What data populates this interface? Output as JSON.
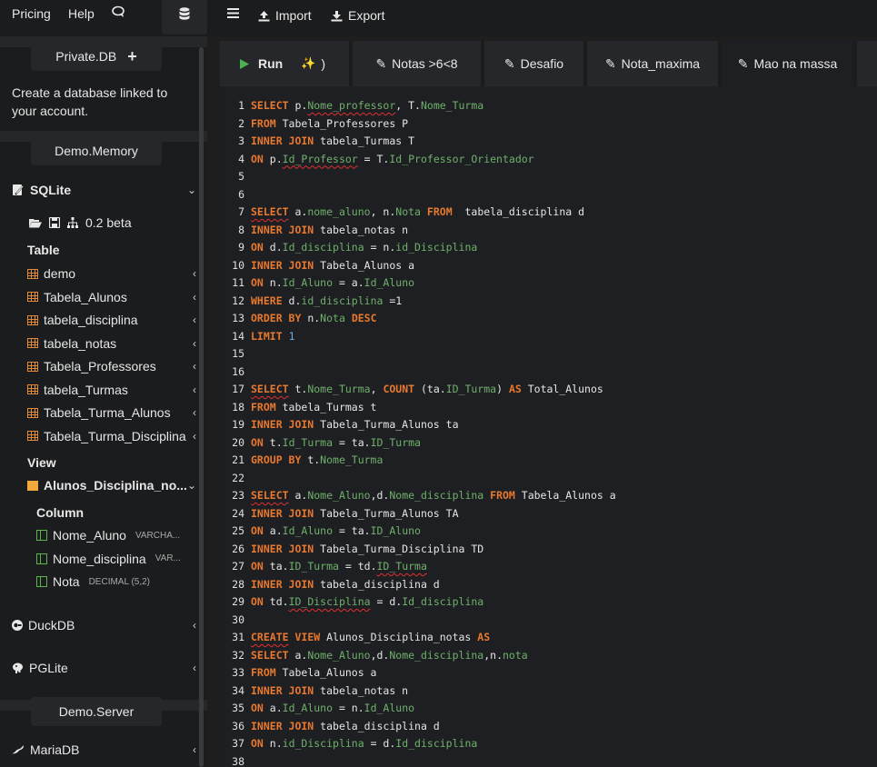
{
  "topbar": {
    "pricing": "Pricing",
    "help": "Help",
    "import_label": "Import",
    "export_label": "Export"
  },
  "sidebar": {
    "private_db": "Private.DB",
    "create_note": "Create a database linked to your account.",
    "demo_memory": "Demo.Memory",
    "sqlite": "SQLite",
    "version": "0.2 beta",
    "table_heading": "Table",
    "tables": [
      "demo",
      "Tabela_Alunos",
      "tabela_disciplina",
      "tabela_notas",
      "Tabela_Professores",
      "tabela_Turmas",
      "Tabela_Turma_Alunos",
      "Tabela_Turma_Disciplina"
    ],
    "view_heading": "View",
    "view_name": "Alunos_Disciplina_no...",
    "column_heading": "Column",
    "columns": [
      {
        "name": "Nome_Aluno",
        "type": "VARCHA..."
      },
      {
        "name": "Nome_disciplina",
        "type": "VAR..."
      },
      {
        "name": "Nota",
        "type": "DECIMAL (5,2)"
      }
    ],
    "duckdb": "DuckDB",
    "pglite": "PGLite",
    "demo_server": "Demo.Server",
    "mariadb": "MariaDB"
  },
  "tabs": {
    "run": "Run",
    "run_suffix": ")",
    "items": [
      "Notas >6<8",
      "Desafio",
      "Nota_maxima",
      "Mao na massa"
    ]
  },
  "editor": {
    "lines": [
      [
        [
          "kw",
          "SELECT"
        ],
        [
          "txt",
          " p."
        ],
        [
          "fld sq",
          "Nome_professor"
        ],
        [
          "txt",
          ", T."
        ],
        [
          "fld",
          "Nome_Turma"
        ]
      ],
      [
        [
          "kw",
          "FROM"
        ],
        [
          "txt",
          " Tabela_Professores P"
        ]
      ],
      [
        [
          "kw",
          "INNER JOIN"
        ],
        [
          "txt",
          " tabela_Turmas T"
        ]
      ],
      [
        [
          "kw",
          "ON"
        ],
        [
          "txt",
          " p."
        ],
        [
          "fld sq",
          "Id_Professor"
        ],
        [
          "txt",
          " = T."
        ],
        [
          "fld",
          "Id_Professor_Orientador"
        ]
      ],
      [],
      [],
      [
        [
          "kw sq",
          "SELECT"
        ],
        [
          "txt",
          " a."
        ],
        [
          "fld",
          "nome_aluno"
        ],
        [
          "txt",
          ", n."
        ],
        [
          "fld",
          "Nota"
        ],
        [
          "txt",
          " "
        ],
        [
          "kw",
          "FROM"
        ],
        [
          "txt",
          "  tabela_disciplina d"
        ]
      ],
      [
        [
          "kw",
          "INNER JOIN"
        ],
        [
          "txt",
          " tabela_notas n"
        ]
      ],
      [
        [
          "kw",
          "ON"
        ],
        [
          "txt",
          " d."
        ],
        [
          "fld",
          "Id_disciplina"
        ],
        [
          "txt",
          " = n."
        ],
        [
          "fld",
          "id_Disciplina"
        ]
      ],
      [
        [
          "kw",
          "INNER JOIN"
        ],
        [
          "txt",
          " Tabela_Alunos a"
        ]
      ],
      [
        [
          "kw",
          "ON"
        ],
        [
          "txt",
          " n."
        ],
        [
          "fld",
          "Id_Aluno"
        ],
        [
          "txt",
          " = a."
        ],
        [
          "fld",
          "Id_Aluno"
        ]
      ],
      [
        [
          "kw",
          "WHERE"
        ],
        [
          "txt",
          " d."
        ],
        [
          "fld",
          "id_disciplina"
        ],
        [
          "txt",
          " =1"
        ]
      ],
      [
        [
          "kw",
          "ORDER BY"
        ],
        [
          "txt",
          " n."
        ],
        [
          "fld",
          "Nota"
        ],
        [
          "txt",
          " "
        ],
        [
          "kw",
          "DESC"
        ]
      ],
      [
        [
          "kw",
          "LIMIT"
        ],
        [
          "txt",
          " "
        ],
        [
          "num",
          "1"
        ]
      ],
      [],
      [],
      [
        [
          "kw sq",
          "SELECT"
        ],
        [
          "txt",
          " t."
        ],
        [
          "fld",
          "Nome_Turma"
        ],
        [
          "txt",
          ", "
        ],
        [
          "kw",
          "COUNT"
        ],
        [
          "txt",
          " (ta."
        ],
        [
          "fld",
          "ID_Turma"
        ],
        [
          "txt",
          ") "
        ],
        [
          "kw",
          "AS"
        ],
        [
          "txt",
          " Total_Alunos"
        ]
      ],
      [
        [
          "kw",
          "FROM"
        ],
        [
          "txt",
          " tabela_Turmas t"
        ]
      ],
      [
        [
          "kw",
          "INNER JOIN"
        ],
        [
          "txt",
          " Tabela_Turma_Alunos ta"
        ]
      ],
      [
        [
          "kw",
          "ON"
        ],
        [
          "txt",
          " t."
        ],
        [
          "fld",
          "Id_Turma"
        ],
        [
          "txt",
          " = ta."
        ],
        [
          "fld",
          "ID_Turma"
        ]
      ],
      [
        [
          "kw",
          "GROUP BY"
        ],
        [
          "txt",
          " t."
        ],
        [
          "fld",
          "Nome_Turma"
        ]
      ],
      [],
      [
        [
          "kw sq",
          "SELECT"
        ],
        [
          "txt",
          " a."
        ],
        [
          "fld",
          "Nome_Aluno"
        ],
        [
          "txt",
          ",d."
        ],
        [
          "fld",
          "Nome_disciplina"
        ],
        [
          "txt",
          " "
        ],
        [
          "kw",
          "FROM"
        ],
        [
          "txt",
          " Tabela_Alunos a"
        ]
      ],
      [
        [
          "kw",
          "INNER JOIN"
        ],
        [
          "txt",
          " Tabela_Turma_Alunos TA"
        ]
      ],
      [
        [
          "kw",
          "ON"
        ],
        [
          "txt",
          " a."
        ],
        [
          "fld",
          "Id_Aluno"
        ],
        [
          "txt",
          " = ta."
        ],
        [
          "fld",
          "ID_Aluno"
        ]
      ],
      [
        [
          "kw",
          "INNER JOIN"
        ],
        [
          "txt",
          " Tabela_Turma_Disciplina TD"
        ]
      ],
      [
        [
          "kw",
          "ON"
        ],
        [
          "txt",
          " ta."
        ],
        [
          "fld",
          "ID_Turma"
        ],
        [
          "txt",
          " = td."
        ],
        [
          "fld sq",
          "ID_Turma"
        ]
      ],
      [
        [
          "kw",
          "INNER JOIN"
        ],
        [
          "txt",
          " tabela_disciplina d"
        ]
      ],
      [
        [
          "kw",
          "ON"
        ],
        [
          "txt",
          " td."
        ],
        [
          "fld sq",
          "ID_Disciplina"
        ],
        [
          "txt",
          " = d."
        ],
        [
          "fld",
          "Id_disciplina"
        ]
      ],
      [],
      [
        [
          "kw sq",
          "CREATE"
        ],
        [
          "txt",
          " "
        ],
        [
          "kw",
          "VIEW"
        ],
        [
          "txt",
          " Alunos_Disciplina_notas "
        ],
        [
          "kw",
          "AS"
        ]
      ],
      [
        [
          "kw",
          "SELECT"
        ],
        [
          "txt",
          " a."
        ],
        [
          "fld",
          "Nome_Aluno"
        ],
        [
          "txt",
          ",d."
        ],
        [
          "fld",
          "Nome_disciplina"
        ],
        [
          "txt",
          ",n."
        ],
        [
          "fld",
          "nota"
        ]
      ],
      [
        [
          "kw",
          "FROM"
        ],
        [
          "txt",
          " Tabela_Alunos a"
        ]
      ],
      [
        [
          "kw",
          "INNER JOIN"
        ],
        [
          "txt",
          " tabela_notas n"
        ]
      ],
      [
        [
          "kw",
          "ON"
        ],
        [
          "txt",
          " a."
        ],
        [
          "fld",
          "Id_Aluno"
        ],
        [
          "txt",
          " = n."
        ],
        [
          "fld",
          "Id_Aluno"
        ]
      ],
      [
        [
          "kw",
          "INNER JOIN"
        ],
        [
          "txt",
          " tabela_disciplina d"
        ]
      ],
      [
        [
          "kw",
          "ON"
        ],
        [
          "txt",
          " n."
        ],
        [
          "fld",
          "id_Disciplina"
        ],
        [
          "txt",
          " = d."
        ],
        [
          "fld",
          "Id_disciplina"
        ]
      ],
      []
    ]
  },
  "colors": {
    "keyword": "#e8792e",
    "field": "#6fb06b",
    "number": "#6fa8dc",
    "table_icon": "#e08a3c",
    "column_icon": "#5fb34f",
    "run_icon": "#4caf50"
  }
}
